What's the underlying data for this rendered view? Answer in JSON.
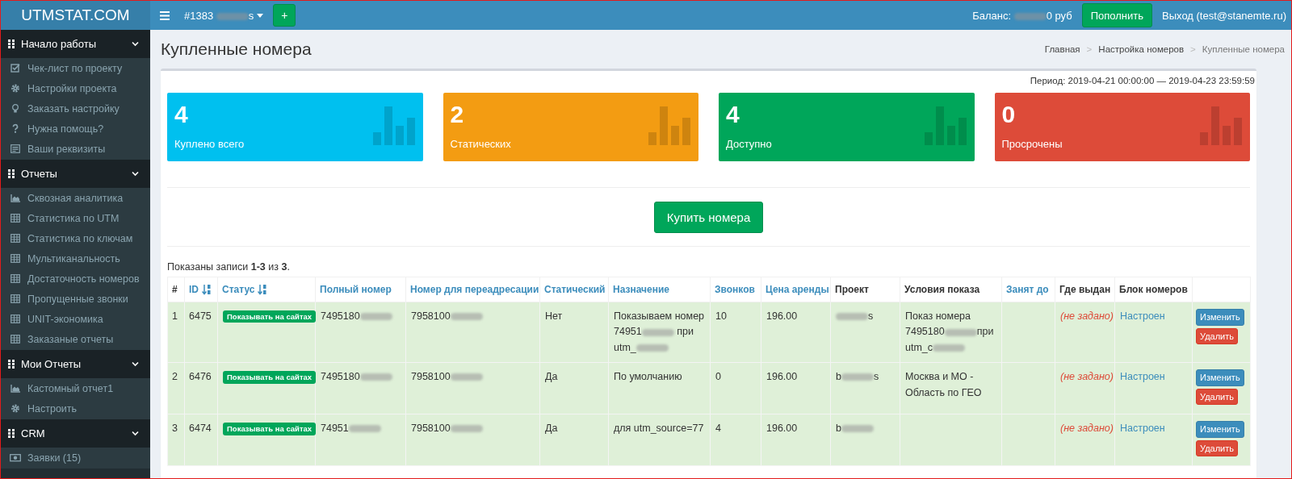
{
  "topbar": {
    "logo": "UTMSTAT.COM",
    "project": [
      {
        "kind": "text",
        "text": "#1383 "
      },
      {
        "kind": "blur"
      },
      {
        "kind": "text",
        "text": "s"
      }
    ],
    "add_button": "+",
    "balance": [
      {
        "kind": "text",
        "text": "Баланс: "
      },
      {
        "kind": "blur"
      },
      {
        "kind": "text",
        "text": "0 руб"
      }
    ],
    "topup_button": "Пополнить",
    "logout": "Выход (test@stanemte.ru)"
  },
  "sidebar": {
    "sections": [
      {
        "label": "Начало работы",
        "expanded": true,
        "items": [
          {
            "kind": "checklist",
            "label": "Чек-лист по проекту"
          },
          {
            "kind": "gear",
            "label": "Настройки проекта"
          },
          {
            "kind": "bulb",
            "label": "Заказать настройку"
          },
          {
            "kind": "question",
            "label": "Нужна помощь?"
          },
          {
            "kind": "card",
            "label": "Ваши реквизиты"
          }
        ]
      },
      {
        "label": "Отчеты",
        "expanded": true,
        "items": [
          {
            "kind": "area",
            "label": "Сквозная аналитика"
          },
          {
            "kind": "table",
            "label": "Статистика по UTM"
          },
          {
            "kind": "table",
            "label": "Статистика по ключам"
          },
          {
            "kind": "table",
            "label": "Мультиканальность"
          },
          {
            "kind": "table",
            "label": "Достаточность номеров"
          },
          {
            "kind": "table",
            "label": "Пропущенные звонки"
          },
          {
            "kind": "table",
            "label": "UNIT-экономика"
          },
          {
            "kind": "table",
            "label": "Заказаные отчеты"
          }
        ]
      },
      {
        "label": "Мои Отчеты",
        "expanded": true,
        "items": [
          {
            "kind": "area",
            "label": "Кастомный отчет1"
          },
          {
            "kind": "gear",
            "label": "Настроить"
          }
        ]
      },
      {
        "label": "CRM",
        "expanded": true,
        "items": [
          {
            "kind": "cash",
            "label": "Заявки (15)"
          }
        ]
      }
    ]
  },
  "page": {
    "title": "Купленные номера",
    "breadcrumb": {
      "separator": ">",
      "items": [
        "Главная",
        "Настройка номеров",
        "Купленные номера"
      ]
    },
    "period": "Период: 2019-04-21 00:00:00 — 2019-04-23 23:59:59",
    "stats": [
      {
        "value": "4",
        "label": "Куплено всего",
        "color": "#00c0ef"
      },
      {
        "value": "2",
        "label": "Статических",
        "color": "#f39c12"
      },
      {
        "value": "4",
        "label": "Доступно",
        "color": "#00a65a"
      },
      {
        "value": "0",
        "label": "Просрочены",
        "color": "#dd4b39"
      }
    ],
    "buy_button": "Купить номера",
    "summary": "Показаны записи **1-3** из **3**.",
    "table": {
      "columns": [
        {
          "label": "#",
          "sortable": false,
          "sort_icon": false
        },
        {
          "label": "ID",
          "sortable": true,
          "sort_icon": true
        },
        {
          "label": "Статус",
          "sortable": true,
          "sort_icon": true
        },
        {
          "label": "Полный номер",
          "sortable": true,
          "sort_icon": false
        },
        {
          "label": "Номер для переадресации",
          "sortable": true,
          "sort_icon": false
        },
        {
          "label": "Статический",
          "sortable": true,
          "sort_icon": false
        },
        {
          "label": "Назначение",
          "sortable": true,
          "sort_icon": false
        },
        {
          "label": "Звонков",
          "sortable": true,
          "sort_icon": false
        },
        {
          "label": "Цена аренды",
          "sortable": true,
          "sort_icon": false
        },
        {
          "label": "Проект",
          "sortable": false,
          "sort_icon": false
        },
        {
          "label": "Условия показа",
          "sortable": false,
          "sort_icon": false
        },
        {
          "label": "Занят до",
          "sortable": true,
          "sort_icon": false
        },
        {
          "label": "Где выдан",
          "sortable": false,
          "sort_icon": false
        },
        {
          "label": "Блок номеров",
          "sortable": false,
          "sort_icon": false
        }
      ],
      "rows": [
        {
          "cells": [
            {
              "kind": "text",
              "parts": [
                {
                  "kind": "text",
                  "text": "1"
                }
              ]
            },
            {
              "kind": "text",
              "parts": [
                {
                  "kind": "text",
                  "text": "6475"
                }
              ]
            },
            {
              "kind": "badge",
              "text": "Показывать на сайтах"
            },
            {
              "kind": "text",
              "parts": [
                {
                  "kind": "text",
                  "text": "7495180"
                },
                {
                  "kind": "blur"
                }
              ]
            },
            {
              "kind": "text",
              "parts": [
                {
                  "kind": "text",
                  "text": "7958100"
                },
                {
                  "kind": "blur"
                }
              ]
            },
            {
              "kind": "text",
              "parts": [
                {
                  "kind": "text",
                  "text": "Нет"
                }
              ]
            },
            {
              "kind": "text",
              "parts": [
                {
                  "kind": "text",
                  "text": "Показываем номер 74951"
                },
                {
                  "kind": "blur"
                },
                {
                  "kind": "text",
                  "text": " при utm_"
                },
                {
                  "kind": "blur"
                }
              ]
            },
            {
              "kind": "text",
              "parts": [
                {
                  "kind": "text",
                  "text": "10"
                }
              ]
            },
            {
              "kind": "text",
              "parts": [
                {
                  "kind": "text",
                  "text": "196.00"
                }
              ]
            },
            {
              "kind": "text",
              "parts": [
                {
                  "kind": "blur"
                },
                {
                  "kind": "text",
                  "text": "s"
                }
              ]
            },
            {
              "kind": "text",
              "parts": [
                {
                  "kind": "text",
                  "text": "Показ номера 7495180"
                },
                {
                  "kind": "blur"
                },
                {
                  "kind": "text",
                  "text": "при utm_c"
                },
                {
                  "kind": "blur"
                }
              ]
            },
            {
              "kind": "empty"
            },
            {
              "kind": "not_set",
              "text": "(не задано)"
            },
            {
              "kind": "link",
              "text": "Настроен"
            },
            {
              "kind": "actions",
              "edit": "Изменить",
              "delete": "Удалить"
            }
          ]
        },
        {
          "cells": [
            {
              "kind": "text",
              "parts": [
                {
                  "kind": "text",
                  "text": "2"
                }
              ]
            },
            {
              "kind": "text",
              "parts": [
                {
                  "kind": "text",
                  "text": "6476"
                }
              ]
            },
            {
              "kind": "badge",
              "text": "Показывать на сайтах"
            },
            {
              "kind": "text",
              "parts": [
                {
                  "kind": "text",
                  "text": "7495180"
                },
                {
                  "kind": "blur"
                }
              ]
            },
            {
              "kind": "text",
              "parts": [
                {
                  "kind": "text",
                  "text": "7958100"
                },
                {
                  "kind": "blur"
                }
              ]
            },
            {
              "kind": "text",
              "parts": [
                {
                  "kind": "text",
                  "text": "Да"
                }
              ]
            },
            {
              "kind": "text",
              "parts": [
                {
                  "kind": "text",
                  "text": "По умолчанию"
                }
              ]
            },
            {
              "kind": "text",
              "parts": [
                {
                  "kind": "text",
                  "text": "0"
                }
              ]
            },
            {
              "kind": "text",
              "parts": [
                {
                  "kind": "text",
                  "text": "196.00"
                }
              ]
            },
            {
              "kind": "text",
              "parts": [
                {
                  "kind": "text",
                  "text": "b"
                },
                {
                  "kind": "blur"
                },
                {
                  "kind": "text",
                  "text": "s"
                }
              ]
            },
            {
              "kind": "text",
              "parts": [
                {
                  "kind": "text",
                  "text": "Москва и МО - Область по ГЕО"
                }
              ]
            },
            {
              "kind": "empty"
            },
            {
              "kind": "not_set",
              "text": "(не задано)"
            },
            {
              "kind": "link",
              "text": "Настроен"
            },
            {
              "kind": "actions",
              "edit": "Изменить",
              "delete": "Удалить"
            }
          ]
        },
        {
          "cells": [
            {
              "kind": "text",
              "parts": [
                {
                  "kind": "text",
                  "text": "3"
                }
              ]
            },
            {
              "kind": "text",
              "parts": [
                {
                  "kind": "text",
                  "text": "6474"
                }
              ]
            },
            {
              "kind": "badge",
              "text": "Показывать на сайтах"
            },
            {
              "kind": "text",
              "parts": [
                {
                  "kind": "text",
                  "text": "74951"
                },
                {
                  "kind": "blur"
                }
              ]
            },
            {
              "kind": "text",
              "parts": [
                {
                  "kind": "text",
                  "text": "7958100"
                },
                {
                  "kind": "blur"
                }
              ]
            },
            {
              "kind": "text",
              "parts": [
                {
                  "kind": "text",
                  "text": "Да"
                }
              ]
            },
            {
              "kind": "text",
              "parts": [
                {
                  "kind": "text",
                  "text": "для utm_source=77"
                }
              ]
            },
            {
              "kind": "text",
              "parts": [
                {
                  "kind": "text",
                  "text": "4"
                }
              ]
            },
            {
              "kind": "text",
              "parts": [
                {
                  "kind": "text",
                  "text": "196.00"
                }
              ]
            },
            {
              "kind": "text",
              "parts": [
                {
                  "kind": "text",
                  "text": "b"
                },
                {
                  "kind": "blur"
                }
              ]
            },
            {
              "kind": "empty"
            },
            {
              "kind": "empty"
            },
            {
              "kind": "not_set",
              "text": "(не задано)"
            },
            {
              "kind": "link",
              "text": "Настроен"
            },
            {
              "kind": "actions",
              "edit": "Изменить",
              "delete": "Удалить"
            }
          ]
        }
      ]
    }
  }
}
